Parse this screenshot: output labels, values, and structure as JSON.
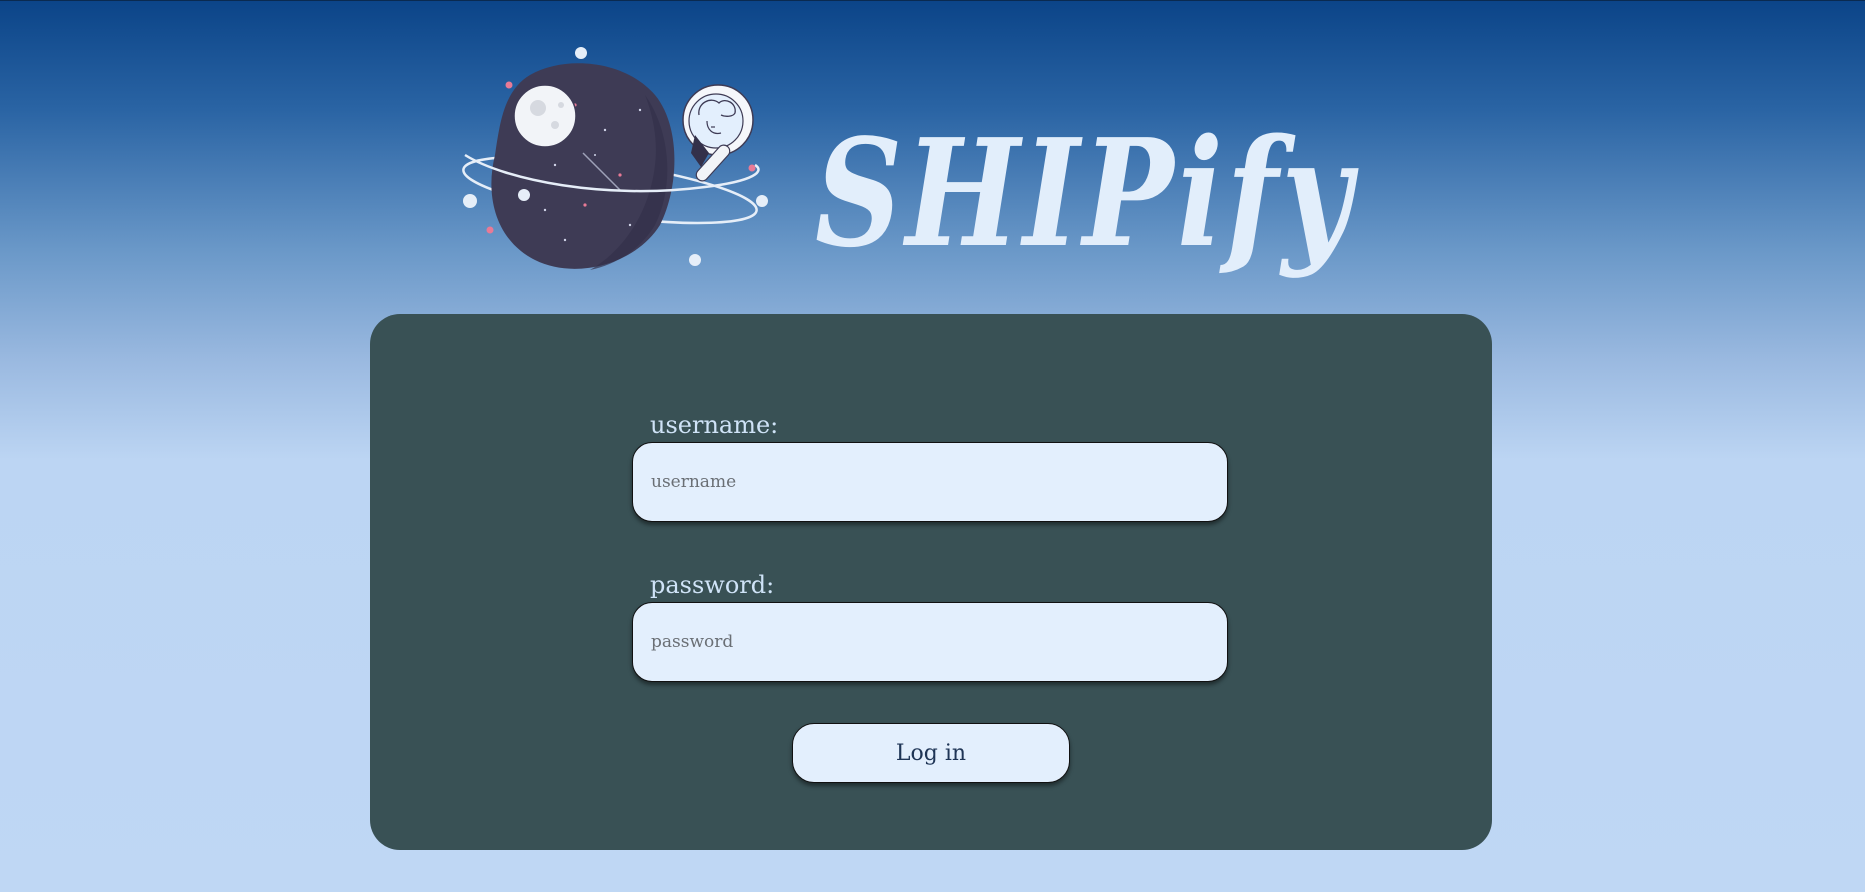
{
  "app": {
    "brand_name": "SHIPify"
  },
  "login_form": {
    "username_label": "username:",
    "username_placeholder": "username",
    "username_value": "",
    "password_label": "password:",
    "password_placeholder": "password",
    "password_value": "",
    "login_button_label": "Log in"
  },
  "icons": {
    "logo": "planet-astronaut-icon"
  },
  "colors": {
    "card_background": "#395155",
    "input_background": "#e3effd",
    "brand_text": "#e2eefb",
    "label_text": "#cfe3f7",
    "page_gradient_top": "#0b4488",
    "page_gradient_bottom": "#bfd7f4",
    "planet": "#3e3b55",
    "accent_pink": "#e87a96"
  }
}
